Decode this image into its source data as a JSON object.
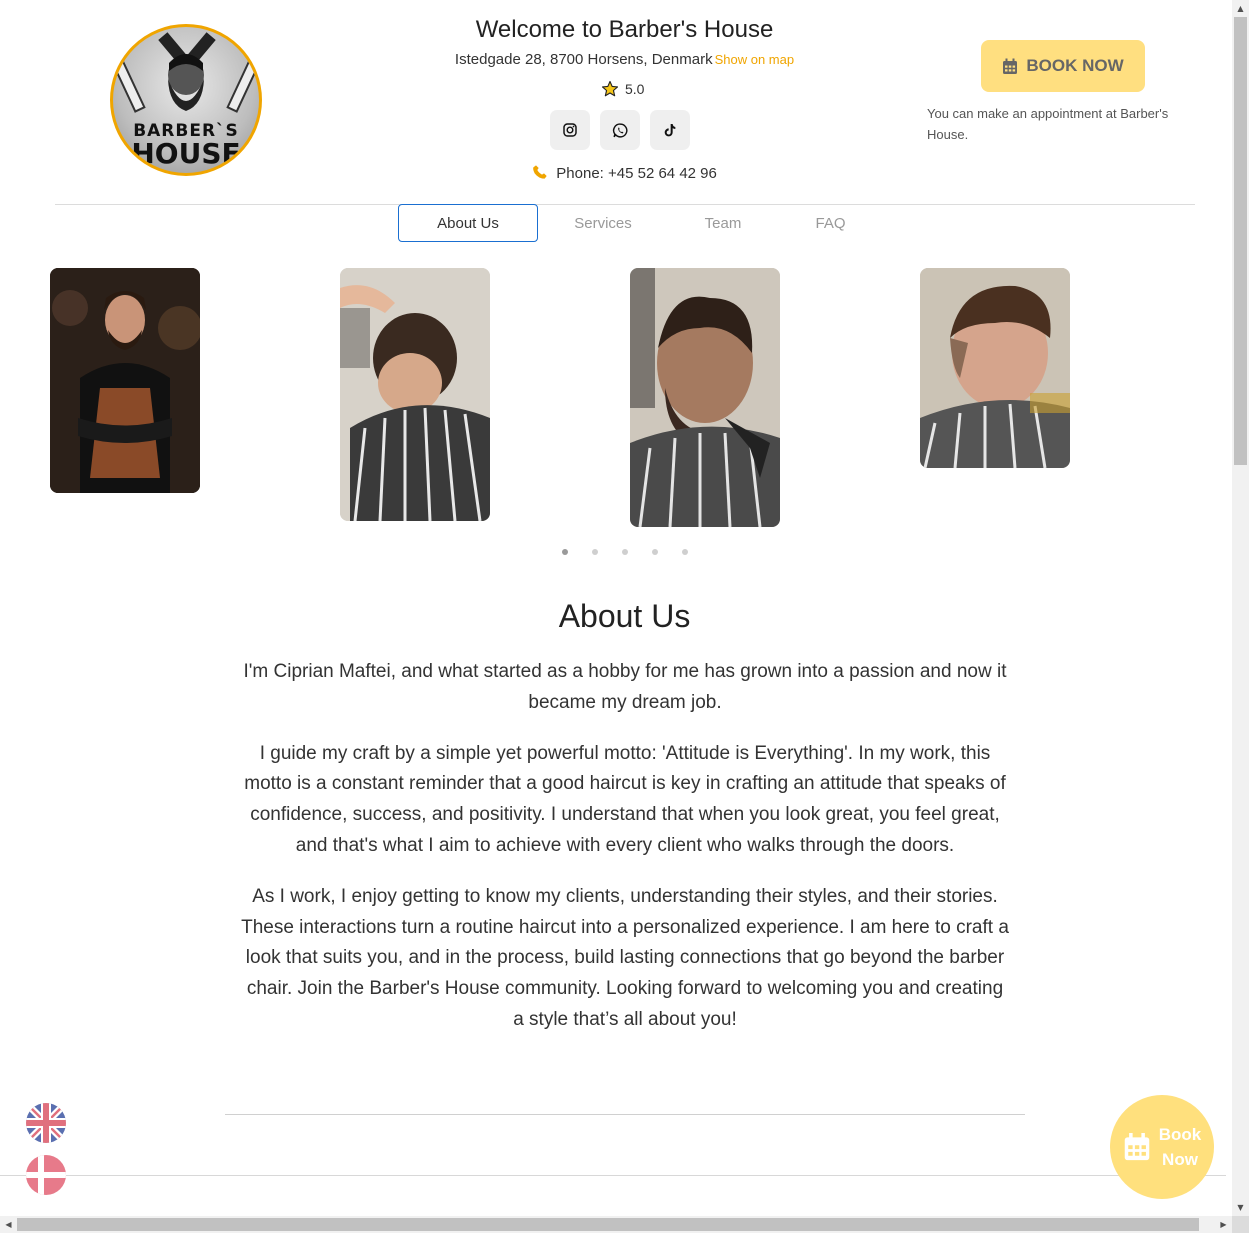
{
  "header": {
    "title": "Welcome to Barber's House",
    "address": "Istedgade 28, 8700 Horsens, Denmark",
    "map_link": "Show on map",
    "rating": "5.0",
    "phone": "Phone: +45 52 64 42 96",
    "logo_text_line1": "BARBER`S",
    "logo_text_line2": "HOUSE"
  },
  "socials": [
    {
      "name": "instagram-icon"
    },
    {
      "name": "whatsapp-icon"
    },
    {
      "name": "tiktok-icon"
    }
  ],
  "booking": {
    "button_label": "BOOK NOW",
    "note": "You can make an appointment at Barber's House."
  },
  "tabs": [
    {
      "label": "About Us",
      "active": true
    },
    {
      "label": "Services",
      "active": false
    },
    {
      "label": "Team",
      "active": false
    },
    {
      "label": "FAQ",
      "active": false
    }
  ],
  "carousel": {
    "slides_total": 5,
    "active_index": 0
  },
  "about": {
    "title": "About Us",
    "paragraphs": [
      "I'm Ciprian Maftei, and what started as a hobby for me has grown into a passion and now it became my dream job.",
      "I guide my craft by a simple yet powerful motto: 'Attitude is Everything'. In my work, this motto is a constant reminder that a good haircut is key in crafting an attitude that speaks of confidence, success, and positivity. I understand that when you look great, you feel great, and that's what I aim to achieve with every client who walks through the doors.",
      "As I work, I enjoy getting to know my clients, understanding their styles, and their stories. These interactions turn a routine haircut into a personalized experience. I am here to craft a look that suits you, and in the process, build lasting connections that go beyond the barber chair. Join the Barber's House community. Looking forward to welcoming you and creating a style that’s all about you!"
    ]
  },
  "floating_book": {
    "line1": "Book",
    "line2": "Now"
  },
  "colors": {
    "accent": "#f0a500",
    "book_button": "#ffdf80",
    "active_tab_border": "#1a6fd1"
  }
}
